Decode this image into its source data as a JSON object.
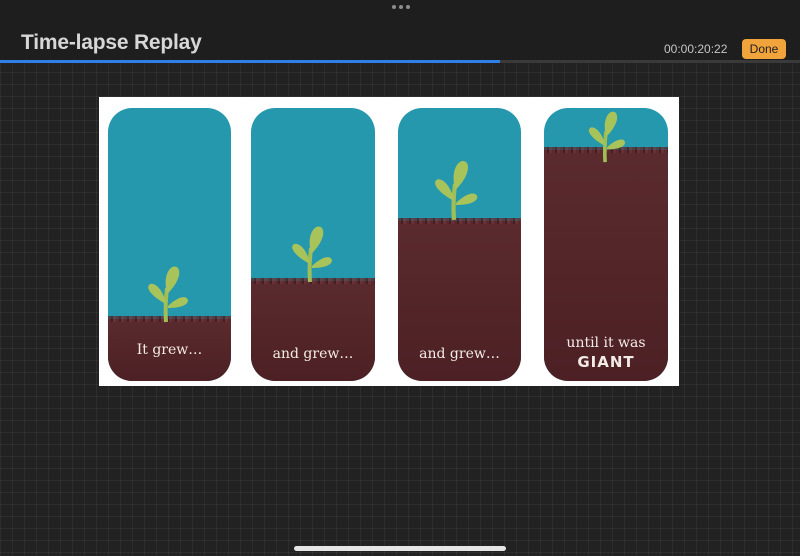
{
  "header": {
    "title": "Time-lapse Replay",
    "timecode": "00:00:20:22",
    "done_label": "Done"
  },
  "playback": {
    "progress": 0.625
  },
  "artwork": {
    "panels": [
      {
        "caption": "It grew…",
        "caption2": ""
      },
      {
        "caption": "and grew…",
        "caption2": ""
      },
      {
        "caption": "and grew…",
        "caption2": ""
      },
      {
        "caption": "until it was",
        "caption2": "GIANT"
      }
    ]
  },
  "colors": {
    "accent": "#2f7fe6",
    "done": "#f0a43b",
    "sky": "#2598ad",
    "soil": "#4c2024",
    "leaf": "#a8c35a"
  },
  "icons": {
    "menu": "more-dots-icon"
  }
}
